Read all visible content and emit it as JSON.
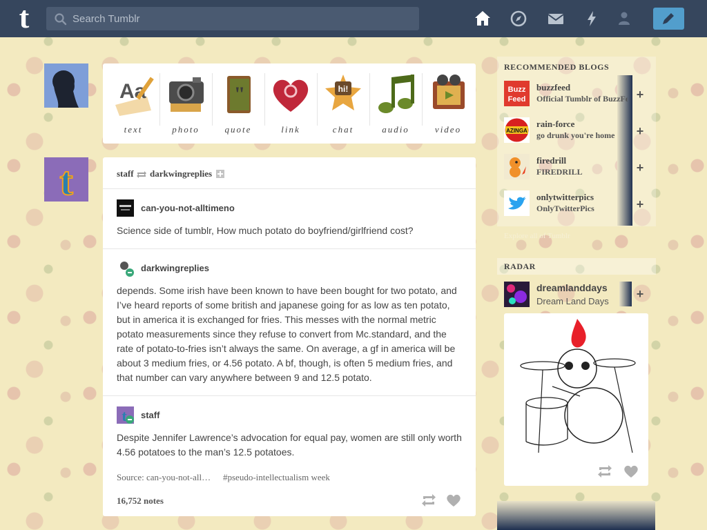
{
  "header": {
    "logo": "t",
    "search_placeholder": "Search Tumblr",
    "nav": [
      "home-icon",
      "explore-compass-icon",
      "messages-envelope-icon",
      "activity-lightning-icon",
      "account-person-icon"
    ],
    "compose_icon": "pencil-icon"
  },
  "post_types": [
    {
      "label": "text",
      "icon": "text-aa-icon"
    },
    {
      "label": "photo",
      "icon": "camera-icon"
    },
    {
      "label": "quote",
      "icon": "quote-book-icon"
    },
    {
      "label": "link",
      "icon": "link-heart-icon"
    },
    {
      "label": "chat",
      "icon": "chat-star-icon"
    },
    {
      "label": "audio",
      "icon": "audio-notes-icon"
    },
    {
      "label": "video",
      "icon": "video-film-icon"
    }
  ],
  "post": {
    "poster": "staff",
    "reblogged_from": "darkwingreplies",
    "thread": [
      {
        "user": "can-you-not-alltimeno",
        "text": "Science side of tumblr, How much potato do boyfriend/girlfriend cost?"
      },
      {
        "user": "darkwingreplies",
        "text": "depends. Some irish have been known to have been bought for two potato, and I’ve heard reports of some british and japanese going for as low as ten potato, but in america it is exchanged for fries. This messes with the normal metric potato measurements since they refuse to convert from Mc.standard, and the rate of potato-to-fries isn’t always the same. On average, a gf in america will be about 3 medium fries, or 4.56 potato. A bf, though, is often 5 medium fries, and that number can vary anywhere between 9 and 12.5 potato."
      },
      {
        "user": "staff",
        "text": "Despite Jennifer Lawrence’s advocation for equal pay, women are still only worth 4.56 potatoes to the man’s 12.5 potatoes."
      }
    ],
    "source": "Source: can-you-not-all…",
    "tag": "#pseudo-intellectualism week",
    "notes": "16,752 notes"
  },
  "sidebar": {
    "recommended_title": "RECOMMENDED BLOGS",
    "blogs": [
      {
        "name": "buzzfeed",
        "title": "Official Tumblr of BuzzFeed",
        "avatar_text": "Buzz Feed"
      },
      {
        "name": "rain-force",
        "title": "go drunk you're home",
        "avatar_text": "AZINGA"
      },
      {
        "name": "firedrill",
        "title": "FIREDRILL"
      },
      {
        "name": "onlytwitterpics",
        "title": "OnlyTwitterPics"
      }
    ],
    "follow_label": "+",
    "explore_label": "Explore all of Tumblr",
    "radar_title": "RADAR",
    "radar": {
      "name": "dreamlanddays",
      "title": "Dream Land Days"
    }
  },
  "colors": {
    "header_bg": "#36465d",
    "compose_bg": "#529ecc",
    "page_bg": "#f3eac0"
  }
}
